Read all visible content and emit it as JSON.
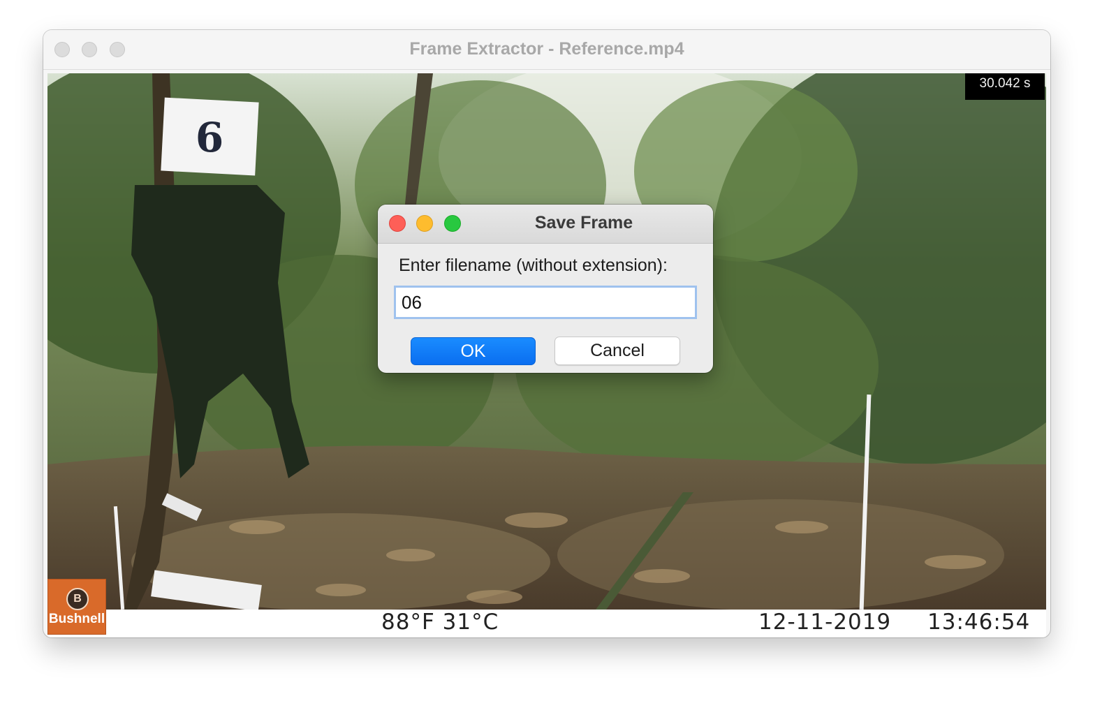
{
  "window": {
    "title": "Frame Extractor - Reference.mp4"
  },
  "video": {
    "timecode": "30.042 s",
    "card_number": "6",
    "temperature": "88°F 31°C",
    "date": "12-11-2019",
    "time": "13:46:54",
    "logo_text": "Bushnell",
    "logo_mark": "B"
  },
  "dialog": {
    "title": "Save Frame",
    "prompt": "Enter filename (without extension):",
    "filename_value": "06",
    "ok_label": "OK",
    "cancel_label": "Cancel"
  },
  "colors": {
    "accent": "#0a6ef0",
    "focus_ring": "#9fc2ee",
    "close": "#fe5f57",
    "minimize": "#febc2e",
    "maximize": "#28c840"
  }
}
